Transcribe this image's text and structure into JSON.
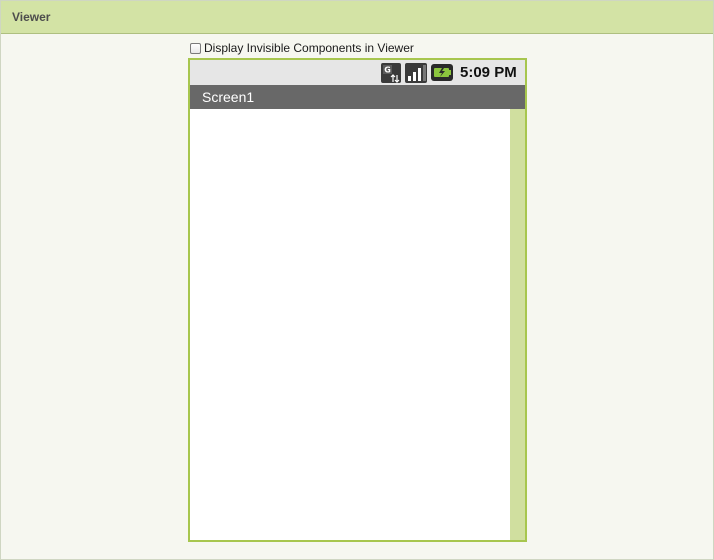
{
  "panel": {
    "title": "Viewer"
  },
  "options": {
    "display_invisible_label": "Display Invisible Components in Viewer",
    "display_invisible_checked": false
  },
  "phone": {
    "status_time": "5:09 PM",
    "status_icons": [
      "data-transfer-icon",
      "signal-strength-icon",
      "battery-icon"
    ],
    "screen_title": "Screen1"
  },
  "colors": {
    "header_bg": "#d3e3a5",
    "phone_border": "#a7c64e",
    "titlebar_bg": "#686868",
    "statusbar_bg": "#e6e6e6",
    "scrollbar": "#d0df9f"
  }
}
